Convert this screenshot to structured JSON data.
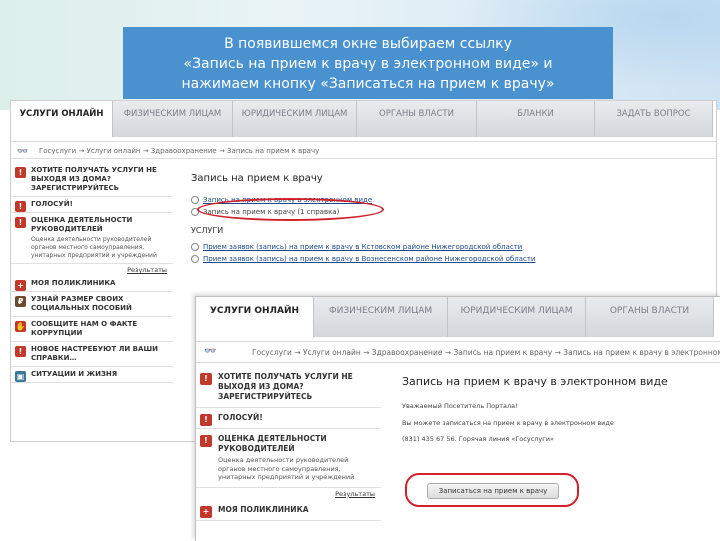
{
  "banner": {
    "line1": "В появившемся окне выбираем ссылку",
    "line2": "«Запись на прием к врачу в электронном виде» и",
    "line3": "нажимаем кнопку «Записаться на прием к врачу»"
  },
  "back": {
    "tabs": [
      "УСЛУГИ ОНЛАЙН",
      "ФИЗИЧЕСКИМ ЛИЦАМ",
      "ЮРИДИЧЕСКИМ ЛИЦАМ",
      "ОРГАНЫ ВЛАСТИ",
      "БЛАНКИ",
      "ЗАДАТЬ ВОПРОС"
    ],
    "breadcrumb": "Госуслуги → Услуги онлайн → Здравоохранение → Запись на прием к врачу",
    "sidebar": [
      {
        "label": "ХОТИТЕ ПОЛУЧАТЬ УСЛУГИ НЕ ВЫХОДЯ ИЗ ДОМА? ЗАРЕГИСТРИРУЙТЕСЬ",
        "desc": ""
      },
      {
        "label": "ГОЛОСУЙ!",
        "desc": ""
      },
      {
        "label": "ОЦЕНКА ДЕЯТЕЛЬНОСТИ РУКОВОДИТЕЛЕЙ",
        "desc": "Оценка деятельности руководителей органов местного самоуправления, унитарных предприятий и учреждений"
      },
      {
        "label": "МОЯ ПОЛИКЛИНИКА",
        "desc": ""
      },
      {
        "label": "УЗНАЙ РАЗМЕР СВОИХ СОЦИАЛЬНЫХ ПОСОБИЙ",
        "desc": ""
      },
      {
        "label": "СООБЩИТЕ НАМ О ФАКТЕ КОРРУПЦИИ",
        "desc": ""
      },
      {
        "label": "НОВОЕ НАСТРЕБУЮТ ЛИ ВАШИ СПРАВКИ…",
        "desc": ""
      },
      {
        "label": "СИТУАЦИИ И ЖИЗНЯ",
        "desc": ""
      }
    ],
    "results_label": "Результаты",
    "heading": "Запись на прием к врачу",
    "radio1": "Запись на прием к врачу в электронном виде",
    "radio2": "Запись на прием к врачу (1 справка)",
    "uslugi": "УСЛУГИ",
    "link1": "Прием заявок (запись) на прием к врачу в Кстовском районе Нижегородской области",
    "link2": "Прием заявок (запись) на прием к врачу в Вознесенском районе Нижегородской области"
  },
  "front": {
    "tabs": [
      "УСЛУГИ ОНЛАЙН",
      "ФИЗИЧЕСКИМ ЛИЦАМ",
      "ЮРИДИЧЕСКИМ ЛИЦАМ",
      "ОРГАНЫ ВЛАСТИ"
    ],
    "breadcrumb": "Госуслуги → Услуги онлайн → Здравоохранение → Запись на прием к врачу → Запись на прием к врачу в электронном виде",
    "sidebar": [
      {
        "label": "ХОТИТЕ ПОЛУЧАТЬ УСЛУГИ НЕ ВЫХОДЯ ИЗ ДОМА? ЗАРЕГИСТРИРУЙТЕСЬ",
        "desc": ""
      },
      {
        "label": "ГОЛОСУЙ!",
        "desc": ""
      },
      {
        "label": "ОЦЕНКА ДЕЯТЕЛЬНОСТИ РУКОВОДИТЕЛЕЙ",
        "desc": "Оценка деятельности руководителей органов местного самоуправления, унитарных предприятий и учреждений"
      },
      {
        "label": "МОЯ ПОЛИКЛИНИКА",
        "desc": ""
      }
    ],
    "results_label": "Результаты",
    "heading": "Запись на прием к врачу в электронном виде",
    "greeting": "Уважаемый Посетитель Портала!",
    "para1": "Вы можете записаться на прием к врачу в электронном виде",
    "para2": "(831) 435 67 56. Горячая линия «Госуслуги»",
    "button": "Записаться на прием к врачу"
  }
}
